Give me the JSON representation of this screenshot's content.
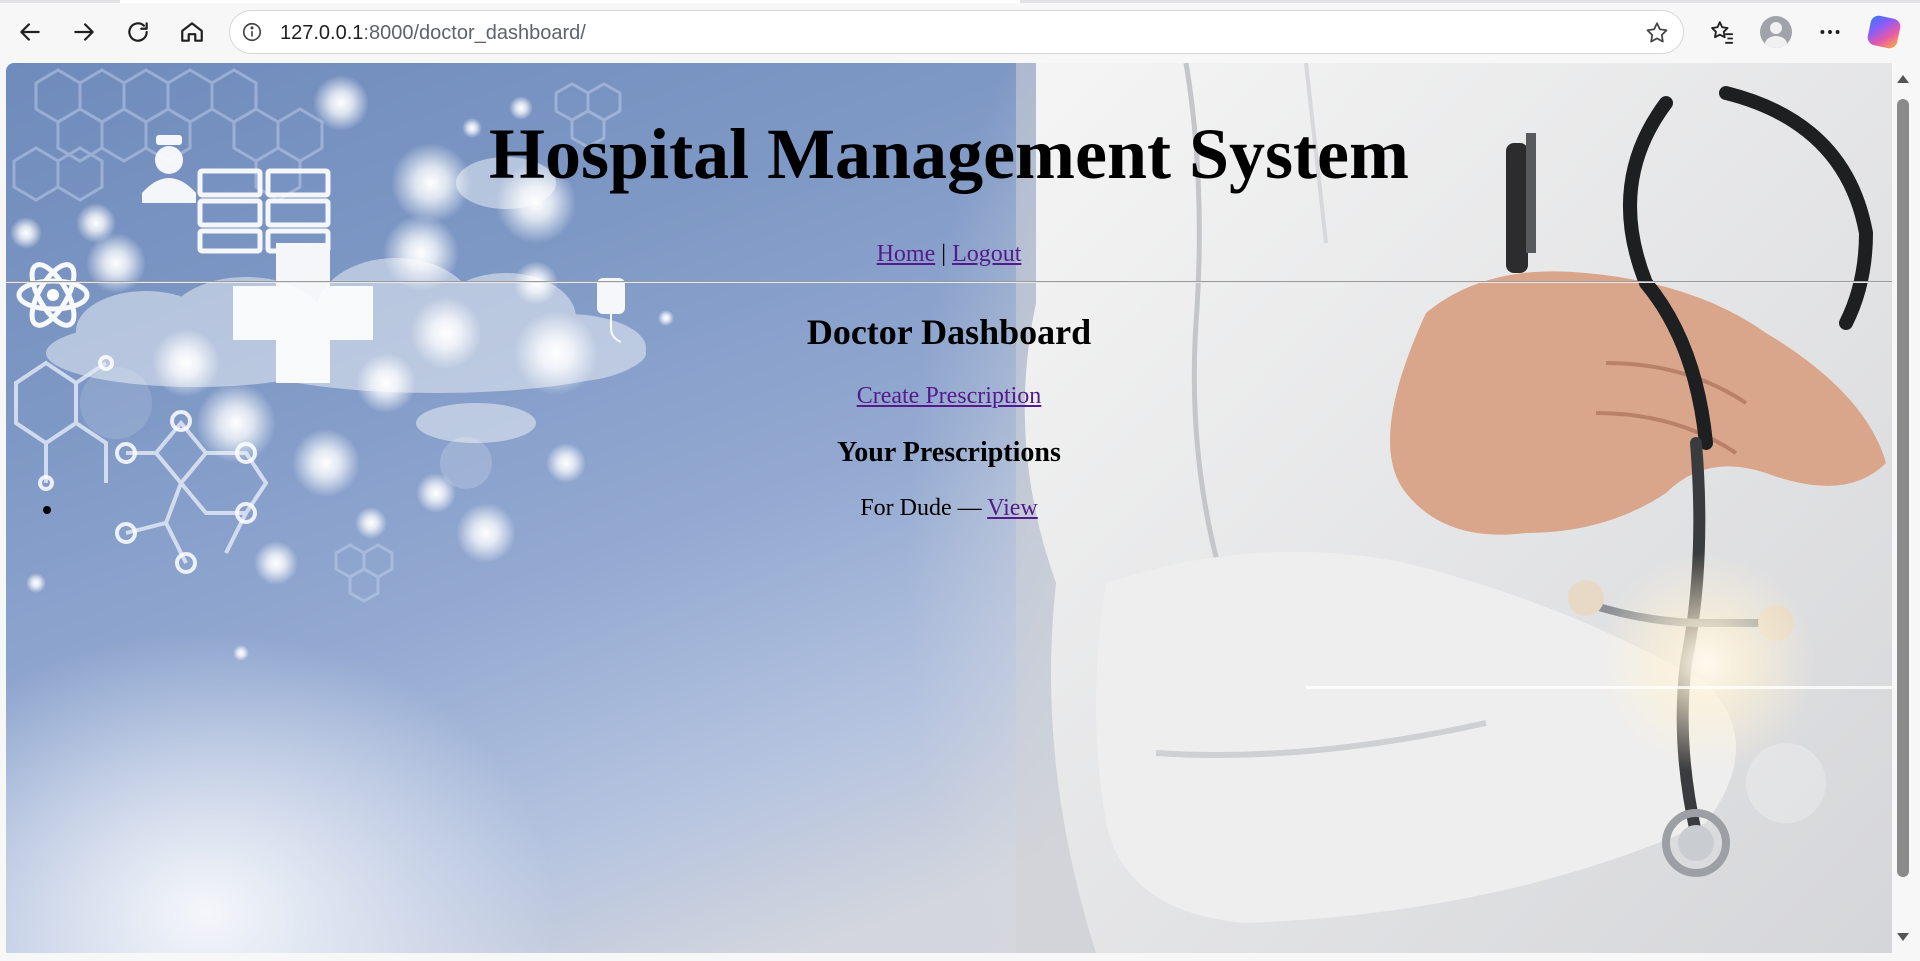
{
  "browser": {
    "url_host": "127.0.0.1",
    "url_rest": ":8000/doctor_dashboard/",
    "icons": {
      "back": "back-arrow-icon",
      "forward": "forward-arrow-icon",
      "reload": "reload-icon",
      "home": "home-icon",
      "site_info": "info-icon",
      "favorite": "star-icon",
      "favorites_list": "favorites-icon",
      "profile": "profile-avatar-icon",
      "menu": "more-options-icon",
      "copilot": "copilot-icon"
    }
  },
  "page": {
    "site_title": "Hospital Management System",
    "nav": {
      "home": "Home",
      "separator": "|",
      "logout": "Logout"
    },
    "dashboard_title": "Doctor Dashboard",
    "create_prescription": "Create Prescription",
    "prescriptions_heading": "Your Prescriptions",
    "prescriptions": [
      {
        "label": "For Dude —",
        "link": "View"
      }
    ]
  },
  "colors": {
    "link": "#551a8b",
    "text": "#000000",
    "chrome_bg": "#f7f7f8"
  }
}
